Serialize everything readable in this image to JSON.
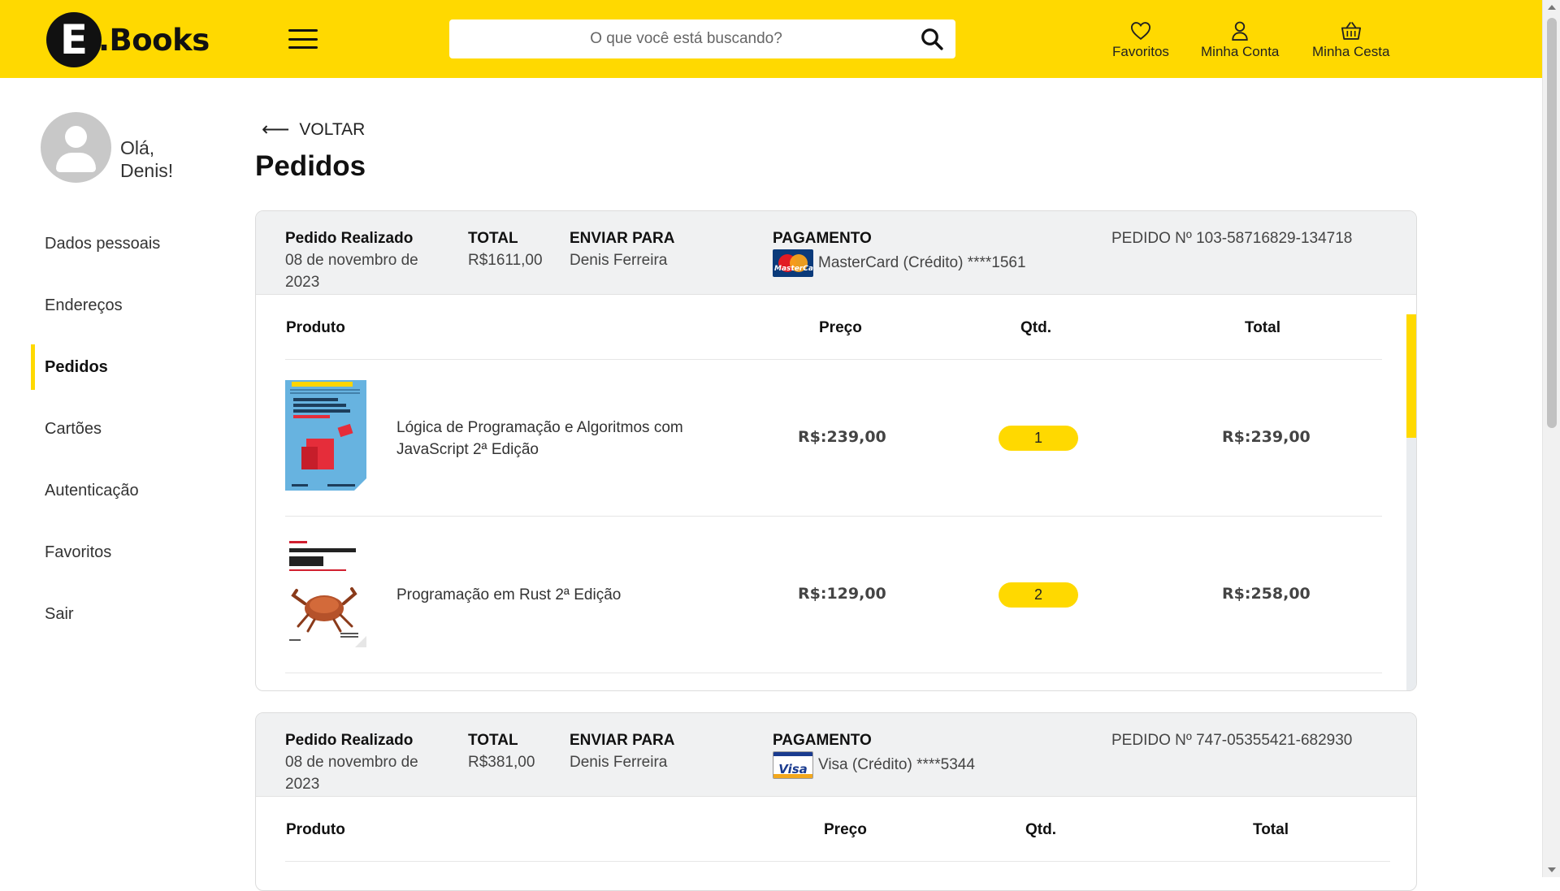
{
  "header": {
    "logo_letter": "E",
    "logo_text": ".Books",
    "search_placeholder": "O que você está buscando?",
    "favorites_label": "Favoritos",
    "account_label": "Minha Conta",
    "basket_label": "Minha Cesta",
    "brand_color": "#FFD900"
  },
  "sidebar": {
    "greeting_line1": "Olá,",
    "greeting_line2": "Denis!",
    "items": [
      {
        "label": "Dados pessoais",
        "active": false
      },
      {
        "label": "Endereços",
        "active": false
      },
      {
        "label": "Pedidos",
        "active": true
      },
      {
        "label": "Cartões",
        "active": false
      },
      {
        "label": "Autenticação",
        "active": false
      },
      {
        "label": "Favoritos",
        "active": false
      },
      {
        "label": "Sair",
        "active": false
      }
    ]
  },
  "main": {
    "back_label": "VOLTAR",
    "title": "Pedidos",
    "orders": [
      {
        "placed_label": "Pedido Realizado",
        "placed_date": "08 de novembro de 2023",
        "total_label": "TOTAL",
        "total": "R$1611,00",
        "ship_label": "ENVIAR PARA",
        "ship_to": "Denis Ferreira",
        "payment_label": "PAGAMENTO",
        "card_brand": "MasterCard",
        "payment": "MasterCard (Crédito) ****1561",
        "order_number": "PEDIDO Nº 103-58716829-134718",
        "columns": {
          "product": "Produto",
          "price": "Preço",
          "qty": "Qtd.",
          "total": "Total"
        },
        "items": [
          {
            "title": "Lógica de Programação e Algoritmos com JavaScript 2ª Edição",
            "price": "R$:239,00",
            "qty": "1",
            "total": "R$:239,00",
            "cover": "logica-js-cover"
          },
          {
            "title": "Programação em Rust 2ª Edição",
            "price": "R$:129,00",
            "qty": "2",
            "total": "R$:258,00",
            "cover": "rust-crab-cover"
          }
        ]
      },
      {
        "placed_label": "Pedido Realizado",
        "placed_date": "08 de novembro de 2023",
        "total_label": "TOTAL",
        "total": "R$381,00",
        "ship_label": "ENVIAR PARA",
        "ship_to": "Denis Ferreira",
        "payment_label": "PAGAMENTO",
        "card_brand": "Visa",
        "payment": "Visa (Crédito) ****5344",
        "order_number": "PEDIDO Nº 747-05355421-682930",
        "columns": {
          "product": "Produto",
          "price": "Preço",
          "qty": "Qtd.",
          "total": "Total"
        },
        "items": []
      }
    ]
  }
}
